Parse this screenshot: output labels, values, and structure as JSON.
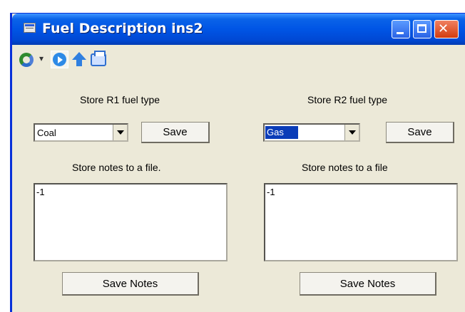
{
  "window": {
    "title": "Fuel Description ins2"
  },
  "toolbar": {
    "icons": [
      "refresh-icon",
      "dropdown-arrow-icon",
      "play-icon",
      "up-arrow-icon",
      "print-icon"
    ]
  },
  "left": {
    "fuel_label": "Store R1 fuel type",
    "fuel_value": "Coal",
    "save_label": "Save",
    "notes_label": "Store notes to a file.",
    "notes_text": "-1",
    "save_notes_label": "Save Notes"
  },
  "right": {
    "fuel_label": "Store R2 fuel type",
    "fuel_value": "Gas",
    "save_label": "Save",
    "notes_label": "Store notes to a file",
    "notes_text": "-1",
    "save_notes_label": "Save Notes"
  },
  "colors": {
    "titlebar": "#0055e5",
    "selection": "#0a3cb8",
    "window_bg": "#ece9d8"
  }
}
